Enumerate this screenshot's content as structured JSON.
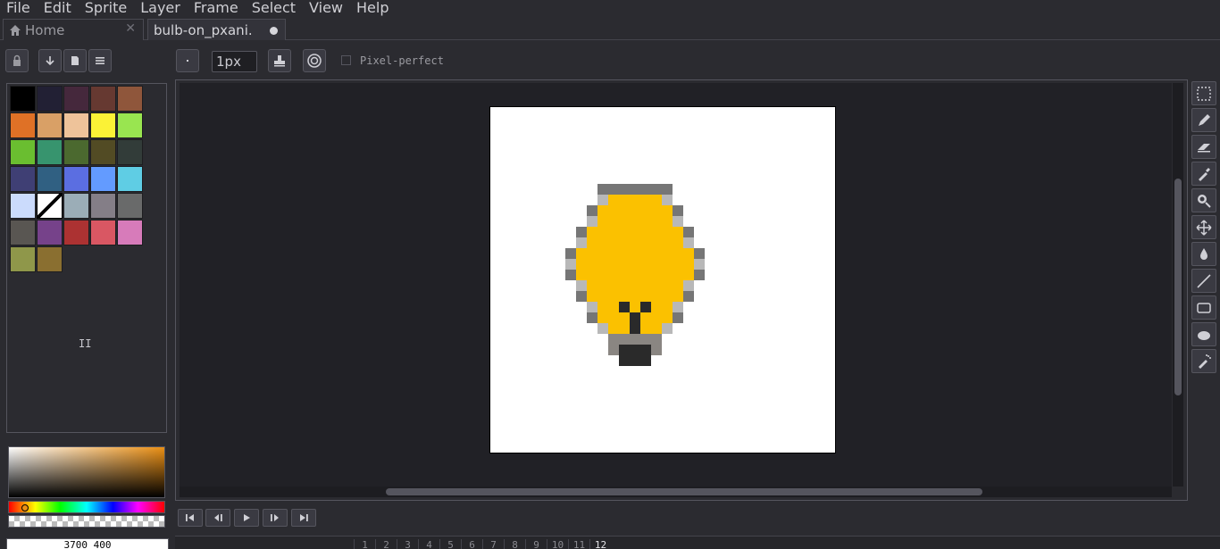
{
  "menu": {
    "items": [
      {
        "label": "File"
      },
      {
        "label": "Edit"
      },
      {
        "label": "Sprite"
      },
      {
        "label": "Layer"
      },
      {
        "label": "Frame"
      },
      {
        "label": "Select"
      },
      {
        "label": "View"
      },
      {
        "label": "Help"
      }
    ]
  },
  "tabs": {
    "home": {
      "label": "Home",
      "close": "✕"
    },
    "active": {
      "label": "bulb-on_pxani."
    }
  },
  "toolbar": {
    "brush_size": "1px",
    "pixel_perfect_label": "Pixel-perfect",
    "pixel_perfect_checked": false
  },
  "palette": {
    "colors": [
      "#000000",
      "#222034",
      "#45283c",
      "#663931",
      "#8f563b",
      "#df7126",
      "#d9a066",
      "#eec39a",
      "#fbf236",
      "#99e550",
      "#6abe30",
      "#37946e",
      "#4b692f",
      "#524b24",
      "#323c39",
      "#3f3f74",
      "#306082",
      "#5b6ee1",
      "#639bff",
      "#5fcde4",
      "#cbdbfc",
      "#ffffff",
      "#9badb7",
      "#847e87",
      "#696a6a",
      "#595652",
      "#76428a",
      "#ac3232",
      "#d95763",
      "#d77bba",
      "#8f974a",
      "#8a6f30"
    ],
    "extra_text": "II"
  },
  "color_picker": {
    "hex_value": "3700 400",
    "accent": "#ea8f14"
  },
  "timeline": {
    "frames": [
      "1",
      "2",
      "3",
      "4",
      "5",
      "6",
      "7",
      "8",
      "9",
      "10",
      "11",
      "12"
    ],
    "current_frame": "12"
  },
  "colors": {
    "bulb_fill": "#fbc100",
    "outline_dark": "#767676",
    "outline_light": "#b8b8b8",
    "base_gray": "#8a8682",
    "base_dark": "#2a2a2a"
  }
}
